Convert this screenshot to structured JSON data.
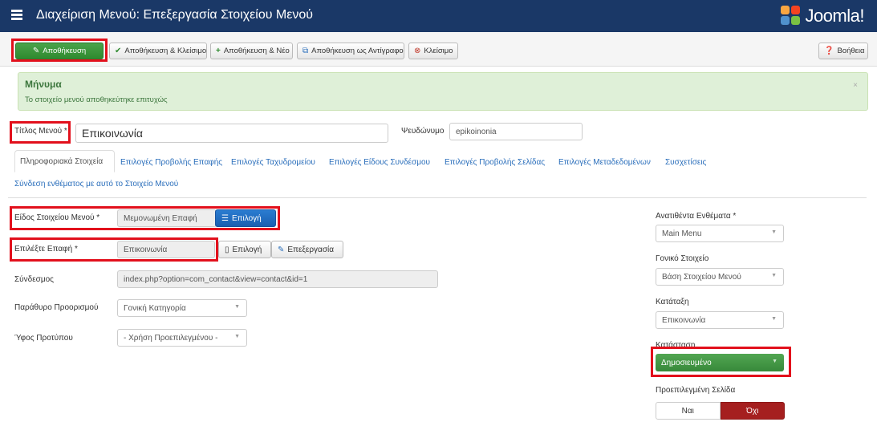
{
  "header": {
    "title": "Διαχείριση Μενού: Επεξεργασία Στοιχείου Μενού",
    "logo_text": "Joomla!"
  },
  "toolbar": {
    "save": "Αποθήκευση",
    "save_close": "Αποθήκευση & Κλείσιμο",
    "save_new": "Αποθήκευση & Νέο",
    "save_copy": "Αποθήκευση ως Αντίγραφο",
    "close": "Κλείσιμο",
    "help": "Βοήθεια"
  },
  "alert": {
    "heading": "Μήνυμα",
    "message": "Το στοιχείο μενού αποθηκεύτηκε επιτυχώς",
    "close": "×"
  },
  "title_field": {
    "label": "Τίτλος Μενού *",
    "value": "Επικοινωνία"
  },
  "alias_field": {
    "label": "Ψευδώνυμο",
    "value": "epikoinonia"
  },
  "tabs": [
    "Πληροφοριακά Στοιχεία",
    "Επιλογές Προβολής Επαφής",
    "Επιλογές Ταχυδρομείου",
    "Επιλογές Είδους Συνδέσμου",
    "Επιλογές Προβολής Σελίδας",
    "Επιλογές Μεταδεδομένων",
    "Συσχετίσεις",
    "Σύνδεση ενθέματος με αυτό το Στοιχείο Μενού"
  ],
  "form": {
    "type_label": "Είδος Στοιχείου Μενού *",
    "type_value": "Μεμονωμένη Επαφή",
    "type_button": "Επιλογή",
    "contact_label": "Επιλέξτε Επαφή *",
    "contact_value": "Επικοινωνία",
    "contact_select": "Επιλογή",
    "contact_edit": "Επεξεργασία",
    "link_label": "Σύνδεσμος",
    "link_value": "index.php?option=com_contact&view=contact&id=1",
    "target_label": "Παράθυρο Προορισμού",
    "target_value": "Γονική Κατηγορία",
    "style_label": "Ύφος Προτύπου",
    "style_value": "- Χρήση Προεπιλεγμένου -"
  },
  "sidebar": {
    "menu_label": "Ανατιθέντα Ενθέματα *",
    "menu_value": "Main Menu",
    "parent_label": "Γονικό Στοιχείο",
    "parent_value": "Βάση Στοιχείου Μενού",
    "order_label": "Κατάταξη",
    "order_value": "Επικοινωνία",
    "status_label": "Κατάσταση",
    "status_value": "Δημοσιευμένο",
    "default_label": "Προεπιλεγμένη Σελίδα",
    "yes": "Ναι",
    "no": "Όχι"
  },
  "colors": {
    "header": "#1a3867",
    "highlight": "#e2101c",
    "save": "#2f8a2f",
    "status": "#37893a",
    "no": "#a51f1f"
  }
}
